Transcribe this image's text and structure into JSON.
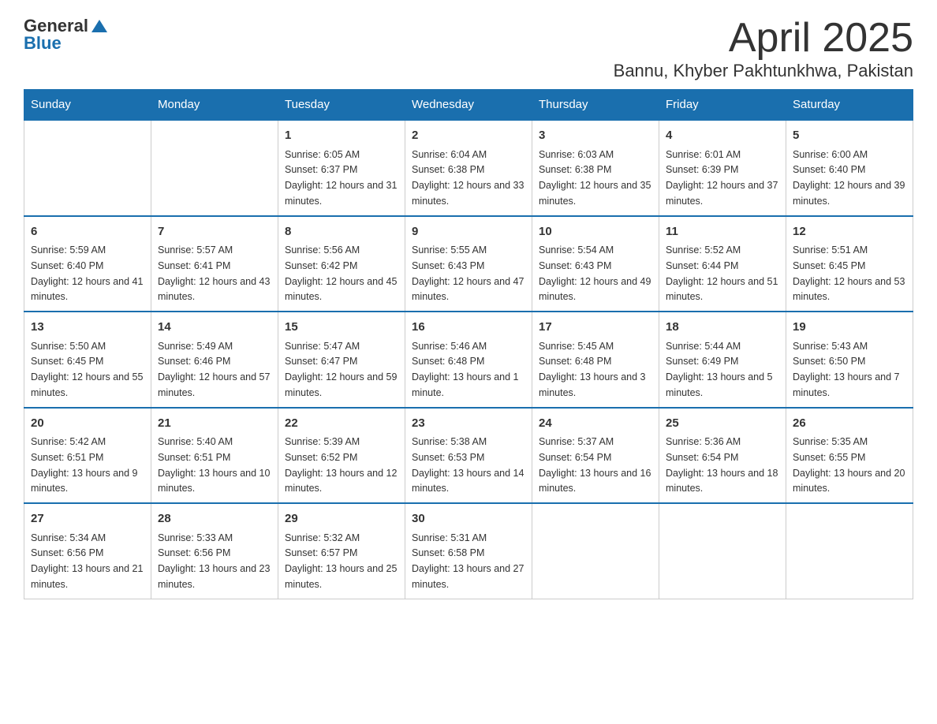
{
  "logo": {
    "text_general": "General",
    "text_blue": "Blue"
  },
  "title": "April 2025",
  "subtitle": "Bannu, Khyber Pakhtunkhwa, Pakistan",
  "days_of_week": [
    "Sunday",
    "Monday",
    "Tuesday",
    "Wednesday",
    "Thursday",
    "Friday",
    "Saturday"
  ],
  "weeks": [
    [
      {
        "day": "",
        "sunrise": "",
        "sunset": "",
        "daylight": ""
      },
      {
        "day": "",
        "sunrise": "",
        "sunset": "",
        "daylight": ""
      },
      {
        "day": "1",
        "sunrise": "Sunrise: 6:05 AM",
        "sunset": "Sunset: 6:37 PM",
        "daylight": "Daylight: 12 hours and 31 minutes."
      },
      {
        "day": "2",
        "sunrise": "Sunrise: 6:04 AM",
        "sunset": "Sunset: 6:38 PM",
        "daylight": "Daylight: 12 hours and 33 minutes."
      },
      {
        "day": "3",
        "sunrise": "Sunrise: 6:03 AM",
        "sunset": "Sunset: 6:38 PM",
        "daylight": "Daylight: 12 hours and 35 minutes."
      },
      {
        "day": "4",
        "sunrise": "Sunrise: 6:01 AM",
        "sunset": "Sunset: 6:39 PM",
        "daylight": "Daylight: 12 hours and 37 minutes."
      },
      {
        "day": "5",
        "sunrise": "Sunrise: 6:00 AM",
        "sunset": "Sunset: 6:40 PM",
        "daylight": "Daylight: 12 hours and 39 minutes."
      }
    ],
    [
      {
        "day": "6",
        "sunrise": "Sunrise: 5:59 AM",
        "sunset": "Sunset: 6:40 PM",
        "daylight": "Daylight: 12 hours and 41 minutes."
      },
      {
        "day": "7",
        "sunrise": "Sunrise: 5:57 AM",
        "sunset": "Sunset: 6:41 PM",
        "daylight": "Daylight: 12 hours and 43 minutes."
      },
      {
        "day": "8",
        "sunrise": "Sunrise: 5:56 AM",
        "sunset": "Sunset: 6:42 PM",
        "daylight": "Daylight: 12 hours and 45 minutes."
      },
      {
        "day": "9",
        "sunrise": "Sunrise: 5:55 AM",
        "sunset": "Sunset: 6:43 PM",
        "daylight": "Daylight: 12 hours and 47 minutes."
      },
      {
        "day": "10",
        "sunrise": "Sunrise: 5:54 AM",
        "sunset": "Sunset: 6:43 PM",
        "daylight": "Daylight: 12 hours and 49 minutes."
      },
      {
        "day": "11",
        "sunrise": "Sunrise: 5:52 AM",
        "sunset": "Sunset: 6:44 PM",
        "daylight": "Daylight: 12 hours and 51 minutes."
      },
      {
        "day": "12",
        "sunrise": "Sunrise: 5:51 AM",
        "sunset": "Sunset: 6:45 PM",
        "daylight": "Daylight: 12 hours and 53 minutes."
      }
    ],
    [
      {
        "day": "13",
        "sunrise": "Sunrise: 5:50 AM",
        "sunset": "Sunset: 6:45 PM",
        "daylight": "Daylight: 12 hours and 55 minutes."
      },
      {
        "day": "14",
        "sunrise": "Sunrise: 5:49 AM",
        "sunset": "Sunset: 6:46 PM",
        "daylight": "Daylight: 12 hours and 57 minutes."
      },
      {
        "day": "15",
        "sunrise": "Sunrise: 5:47 AM",
        "sunset": "Sunset: 6:47 PM",
        "daylight": "Daylight: 12 hours and 59 minutes."
      },
      {
        "day": "16",
        "sunrise": "Sunrise: 5:46 AM",
        "sunset": "Sunset: 6:48 PM",
        "daylight": "Daylight: 13 hours and 1 minute."
      },
      {
        "day": "17",
        "sunrise": "Sunrise: 5:45 AM",
        "sunset": "Sunset: 6:48 PM",
        "daylight": "Daylight: 13 hours and 3 minutes."
      },
      {
        "day": "18",
        "sunrise": "Sunrise: 5:44 AM",
        "sunset": "Sunset: 6:49 PM",
        "daylight": "Daylight: 13 hours and 5 minutes."
      },
      {
        "day": "19",
        "sunrise": "Sunrise: 5:43 AM",
        "sunset": "Sunset: 6:50 PM",
        "daylight": "Daylight: 13 hours and 7 minutes."
      }
    ],
    [
      {
        "day": "20",
        "sunrise": "Sunrise: 5:42 AM",
        "sunset": "Sunset: 6:51 PM",
        "daylight": "Daylight: 13 hours and 9 minutes."
      },
      {
        "day": "21",
        "sunrise": "Sunrise: 5:40 AM",
        "sunset": "Sunset: 6:51 PM",
        "daylight": "Daylight: 13 hours and 10 minutes."
      },
      {
        "day": "22",
        "sunrise": "Sunrise: 5:39 AM",
        "sunset": "Sunset: 6:52 PM",
        "daylight": "Daylight: 13 hours and 12 minutes."
      },
      {
        "day": "23",
        "sunrise": "Sunrise: 5:38 AM",
        "sunset": "Sunset: 6:53 PM",
        "daylight": "Daylight: 13 hours and 14 minutes."
      },
      {
        "day": "24",
        "sunrise": "Sunrise: 5:37 AM",
        "sunset": "Sunset: 6:54 PM",
        "daylight": "Daylight: 13 hours and 16 minutes."
      },
      {
        "day": "25",
        "sunrise": "Sunrise: 5:36 AM",
        "sunset": "Sunset: 6:54 PM",
        "daylight": "Daylight: 13 hours and 18 minutes."
      },
      {
        "day": "26",
        "sunrise": "Sunrise: 5:35 AM",
        "sunset": "Sunset: 6:55 PM",
        "daylight": "Daylight: 13 hours and 20 minutes."
      }
    ],
    [
      {
        "day": "27",
        "sunrise": "Sunrise: 5:34 AM",
        "sunset": "Sunset: 6:56 PM",
        "daylight": "Daylight: 13 hours and 21 minutes."
      },
      {
        "day": "28",
        "sunrise": "Sunrise: 5:33 AM",
        "sunset": "Sunset: 6:56 PM",
        "daylight": "Daylight: 13 hours and 23 minutes."
      },
      {
        "day": "29",
        "sunrise": "Sunrise: 5:32 AM",
        "sunset": "Sunset: 6:57 PM",
        "daylight": "Daylight: 13 hours and 25 minutes."
      },
      {
        "day": "30",
        "sunrise": "Sunrise: 5:31 AM",
        "sunset": "Sunset: 6:58 PM",
        "daylight": "Daylight: 13 hours and 27 minutes."
      },
      {
        "day": "",
        "sunrise": "",
        "sunset": "",
        "daylight": ""
      },
      {
        "day": "",
        "sunrise": "",
        "sunset": "",
        "daylight": ""
      },
      {
        "day": "",
        "sunrise": "",
        "sunset": "",
        "daylight": ""
      }
    ]
  ]
}
